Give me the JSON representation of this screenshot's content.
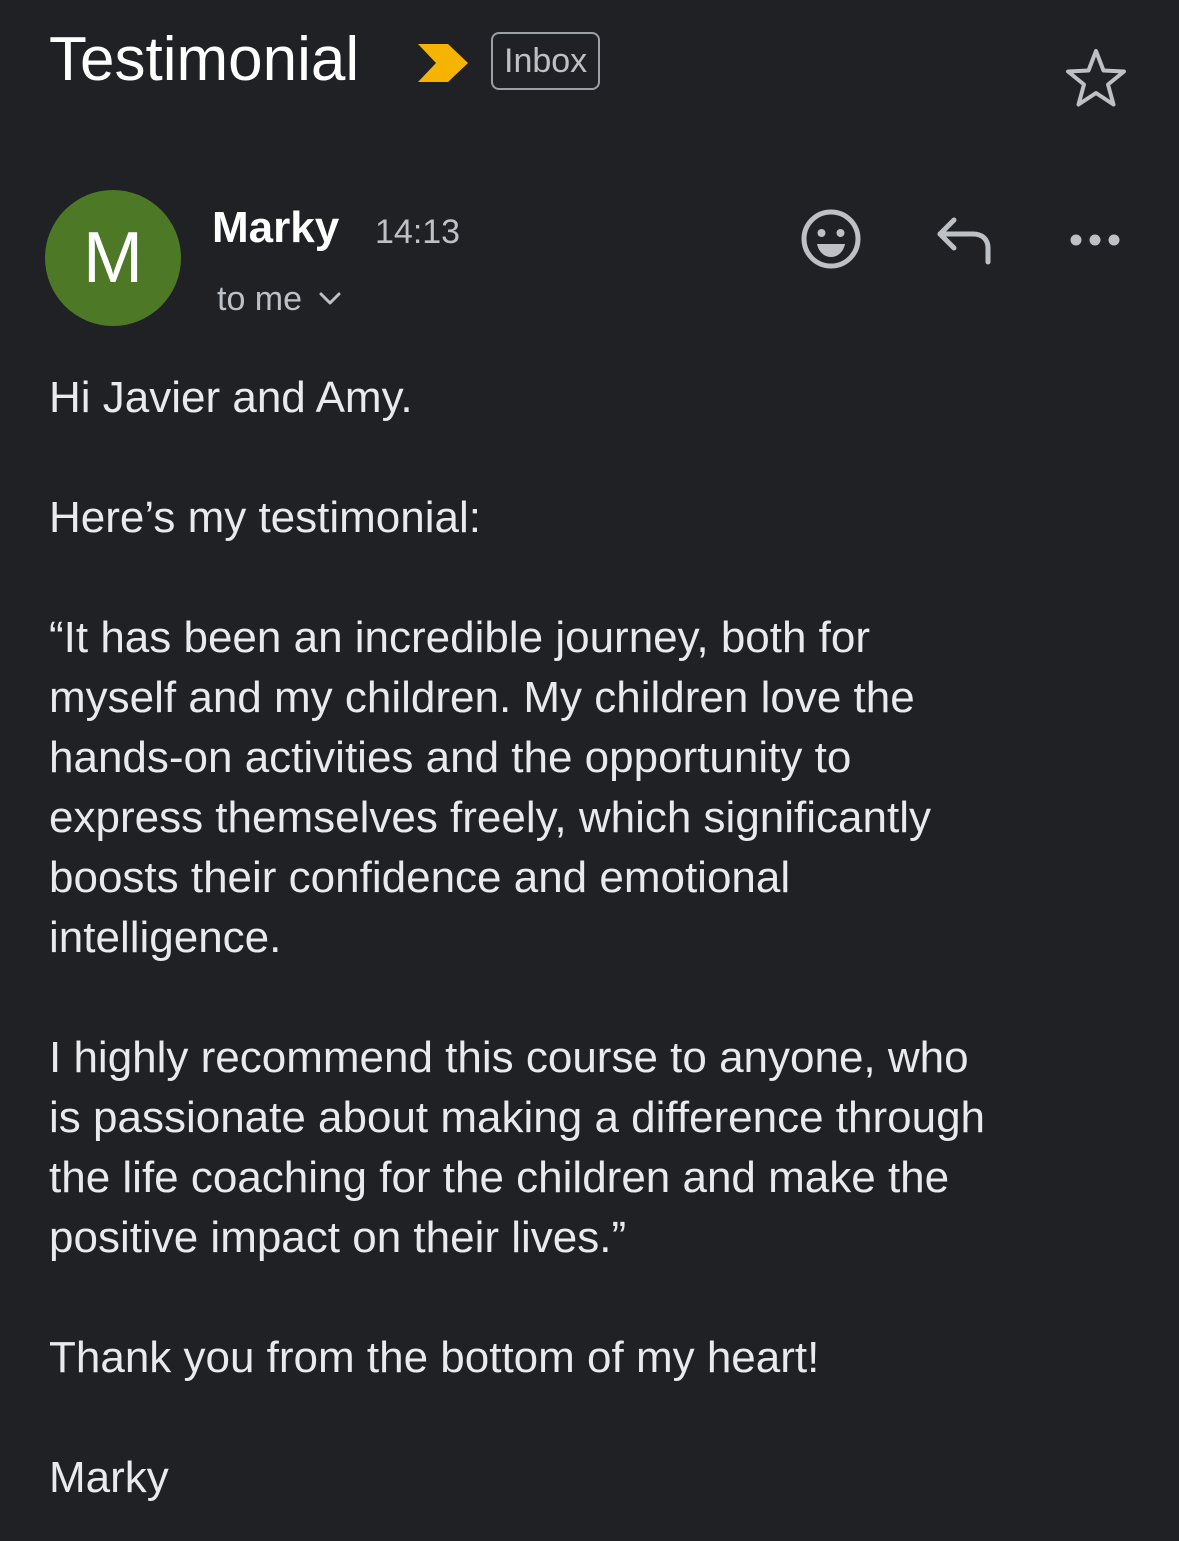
{
  "subject": {
    "title": "Testimonial",
    "importance_icon": "importance-marker-icon",
    "label": "Inbox",
    "star_icon": "star-outline-icon"
  },
  "header": {
    "avatar_letter": "M",
    "avatar_color": "#4d7826",
    "sender": "Marky",
    "time": "14:13",
    "recipients": "to me",
    "actions": {
      "emoji_icon": "add-reaction-icon",
      "reply_icon": "reply-icon",
      "more_icon": "more-options-icon"
    }
  },
  "body": {
    "greeting": "Hi Javier and Amy.",
    "intro": "Here’s my testimonial:",
    "quote_1": "“It has been an incredible journey, both for\nmyself and my children. My children love the\nhands-on activities and the opportunity to\nexpress themselves freely, which significantly\nboosts their confidence and emotional\nintelligence.",
    "quote_2": "I highly recommend this course to anyone, who\nis passionate about making a difference through\nthe life coaching for the children and make the\npositive impact on their lives.”",
    "thanks": "Thank you from the bottom of my heart!",
    "signature": "Marky"
  },
  "colors": {
    "background": "#202124",
    "importance": "#f4b400",
    "secondary_text": "#bdc1c6"
  }
}
